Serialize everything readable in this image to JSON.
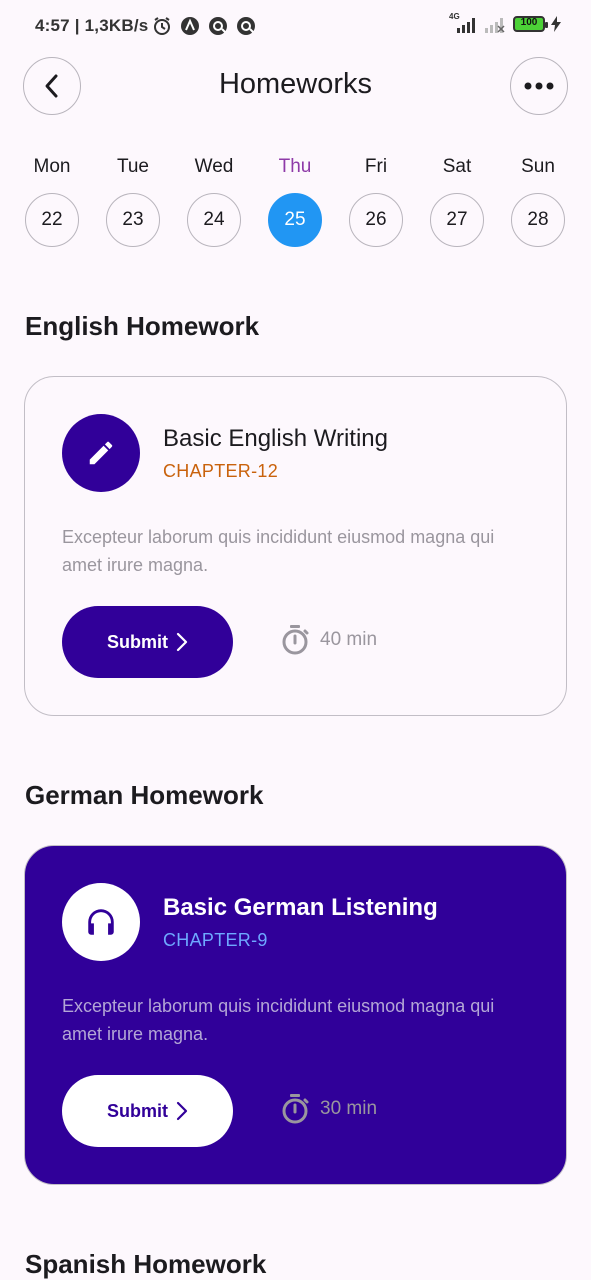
{
  "status_bar": {
    "time": "4:57",
    "network_speed": "| 1,3KB/s",
    "network_type": "4G",
    "battery": "100"
  },
  "header": {
    "title": "Homeworks"
  },
  "calendar": {
    "days": [
      {
        "name": "Mon",
        "number": "22"
      },
      {
        "name": "Tue",
        "number": "23"
      },
      {
        "name": "Wed",
        "number": "24"
      },
      {
        "name": "Thu",
        "number": "25"
      },
      {
        "name": "Fri",
        "number": "26"
      },
      {
        "name": "Sat",
        "number": "27"
      },
      {
        "name": "Sun",
        "number": "28"
      }
    ],
    "selected": "Thu"
  },
  "sections": [
    {
      "title": "English Homework",
      "card": {
        "title": "Basic English Writing",
        "chapter": "CHAPTER-12",
        "description": "Excepteur laborum quis incididunt eiusmod magna qui amet irure magna.",
        "button": "Submit",
        "duration": "40 min",
        "icon": "pencil-icon"
      }
    },
    {
      "title": "German Homework",
      "card": {
        "title": "Basic German Listening",
        "chapter": "CHAPTER-9",
        "description": "Excepteur laborum quis incididunt eiusmod magna qui amet irure magna.",
        "button": "Submit",
        "duration": "30 min",
        "icon": "headphones-icon"
      }
    },
    {
      "title": "Spanish Homework"
    }
  ],
  "colors": {
    "primary": "#310099",
    "selected_day": "#2196f3",
    "chapter_light": "#c9620c",
    "chapter_dark": "#6ea8ff",
    "background": "#fdf8fd"
  }
}
